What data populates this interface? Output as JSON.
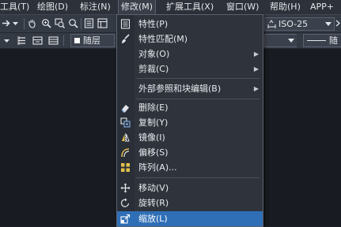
{
  "menubar": {
    "items": [
      "工具(T)",
      "绘图(D)",
      "标注(N)",
      "修改(M)",
      "扩展工具(X)",
      "窗口(W)",
      "帮助(H)",
      "APP+"
    ]
  },
  "toolbar": {
    "dimstyle_value": "ISO-25",
    "layer_value": "随层",
    "linetype_value": "随"
  },
  "menu": {
    "items": [
      {
        "label": "特性(P)",
        "icon": "properties-icon"
      },
      {
        "label": "特性匹配(M)",
        "icon": "match-properties-brush-icon"
      },
      {
        "label": "对象(O)",
        "submenu": true
      },
      {
        "label": "剪裁(C)",
        "submenu": true
      },
      {
        "label": "外部参照和块编辑(B)",
        "submenu": true
      },
      {
        "label": "删除(E)",
        "icon": "eraser-icon"
      },
      {
        "label": "复制(Y)",
        "icon": "copy-icon"
      },
      {
        "label": "镜像(I)",
        "icon": "mirror-icon"
      },
      {
        "label": "偏移(S)",
        "icon": "offset-icon"
      },
      {
        "label": "阵列(A)...",
        "icon": "array-icon"
      },
      {
        "label": "移动(V)",
        "icon": "move-icon"
      },
      {
        "label": "旋转(R)",
        "icon": "rotate-icon"
      },
      {
        "label": "缩放(L)",
        "icon": "scale-icon",
        "highlighted": true
      }
    ]
  },
  "colors": {
    "highlight": "#2f6fb6",
    "menu_bg": "#2f343c",
    "toolbar_bg": "#343a44",
    "canvas_bg": "#181b21"
  }
}
